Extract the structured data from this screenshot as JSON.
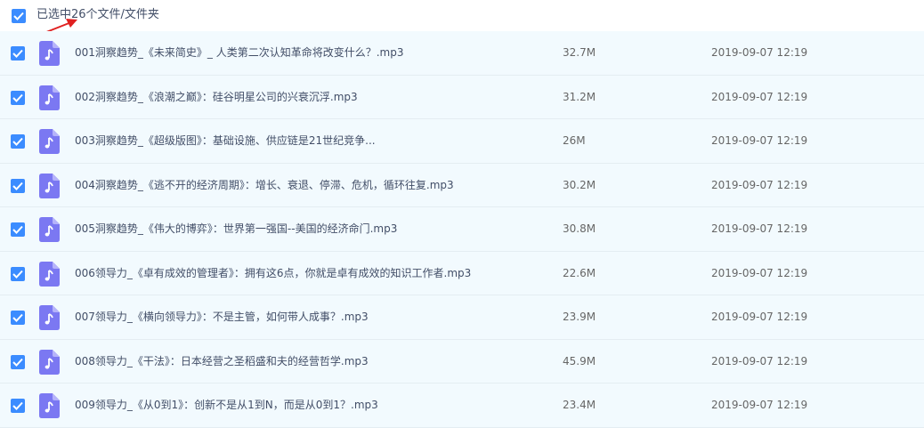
{
  "header": {
    "selection_text": "已选中26个文件/文件夹"
  },
  "colors": {
    "checkbox": "#3b8cff",
    "row_bg": "#f2fafe",
    "file_icon": "#7b78f2",
    "arrow": "#e02020"
  },
  "files": [
    {
      "name": "001洞察趋势_《未来简史》_ 人类第二次认知革命将改变什么？.mp3",
      "size": "32.7M",
      "date": "2019-09-07 12:19"
    },
    {
      "name": "002洞察趋势_《浪潮之巅》：硅谷明星公司的兴衰沉浮.mp3",
      "size": "31.2M",
      "date": "2019-09-07 12:19"
    },
    {
      "name": "003洞察趋势_《超级版图》：基础设施、供应链是21世纪竞争...",
      "size": "26M",
      "date": "2019-09-07 12:19"
    },
    {
      "name": "004洞察趋势_《逃不开的经济周期》：增长、衰退、停滞、危机，循环往复.mp3",
      "size": "30.2M",
      "date": "2019-09-07 12:19"
    },
    {
      "name": "005洞察趋势_《伟大的博弈》：世界第一强国--美国的经济命门.mp3",
      "size": "30.8M",
      "date": "2019-09-07 12:19"
    },
    {
      "name": "006领导力_《卓有成效的管理者》：拥有这6点，你就是卓有成效的知识工作者.mp3",
      "size": "22.6M",
      "date": "2019-09-07 12:19"
    },
    {
      "name": "007领导力_《横向领导力》：不是主管，如何带人成事？.mp3",
      "size": "23.9M",
      "date": "2019-09-07 12:19"
    },
    {
      "name": "008领导力_《干法》：日本经营之圣稻盛和夫的经营哲学.mp3",
      "size": "45.9M",
      "date": "2019-09-07 12:19"
    },
    {
      "name": "009领导力_《从0到1》：创新不是从1到N，而是从0到1？.mp3",
      "size": "23.4M",
      "date": "2019-09-07 12:19"
    }
  ]
}
